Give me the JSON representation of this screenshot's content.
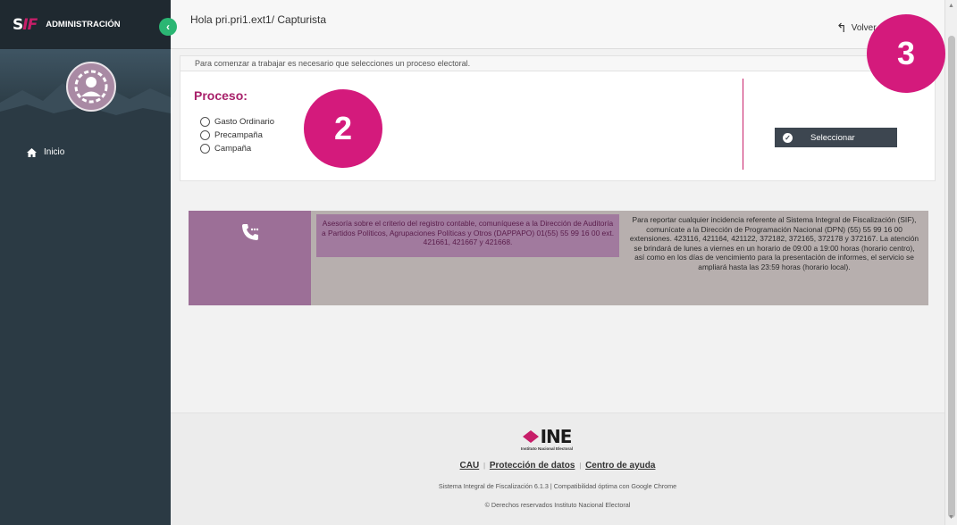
{
  "sidebar": {
    "logo_s": "S",
    "logo_f": "IF",
    "title": "ADMINISTRACIÓN",
    "menu": [
      {
        "label": "Inicio",
        "icon": "home-icon"
      }
    ]
  },
  "topbar": {
    "greeting": "Hola pri.pri1.ext1/ Capturista",
    "back_label": "Volver"
  },
  "main": {
    "notice": "Para comenzar a trabajar es necesario que selecciones un proceso electoral.",
    "proceso_title": "Proceso:",
    "options": [
      "Gasto Ordinario",
      "Precampaña",
      "Campaña"
    ],
    "select_label": "Seleccionar"
  },
  "contact": {
    "advice": "Asesoría sobre el criterio del registro contable, comuníquese a la Dirección de Auditoría a Partidos Políticos, Agrupaciones Políticas y Otros (DAPPAPO) 01(55) 55 99 16 00 ext. 421661, 421667 y 421668.",
    "incidents": "Para reportar cualquier incidencia referente al Sistema Integral de Fiscalización (SIF), comunícate a la Dirección de Programación Nacional (DPN) (55) 55 99 16 00 extensiones. 423116, 421164, 421122, 372182, 372165, 372178 y 372167. La atención se brindará de lunes a viernes en un horario de 09:00 a 19:00 horas (horario centro), así como en los días de vencimiento para la presentación de informes, el servicio se ampliará hasta las 23:59 horas (horario local)."
  },
  "footer": {
    "ine_text": "INE",
    "ine_sub": "Instituto Nacional Electoral",
    "links": [
      "CAU",
      "Protección de datos",
      "Centro de ayuda"
    ],
    "info": "Sistema Integral de Fiscalización 6.1.3 | Compatibilidad óptima con Google Chrome",
    "copyright": "© Derechos reservados Instituto Nacional Electoral"
  },
  "badges": [
    "2",
    "3"
  ],
  "colors": {
    "accent": "#c71e69",
    "sidebar": "#2b3a44",
    "toggle": "#2bb673",
    "badge": "#d41a7c"
  }
}
